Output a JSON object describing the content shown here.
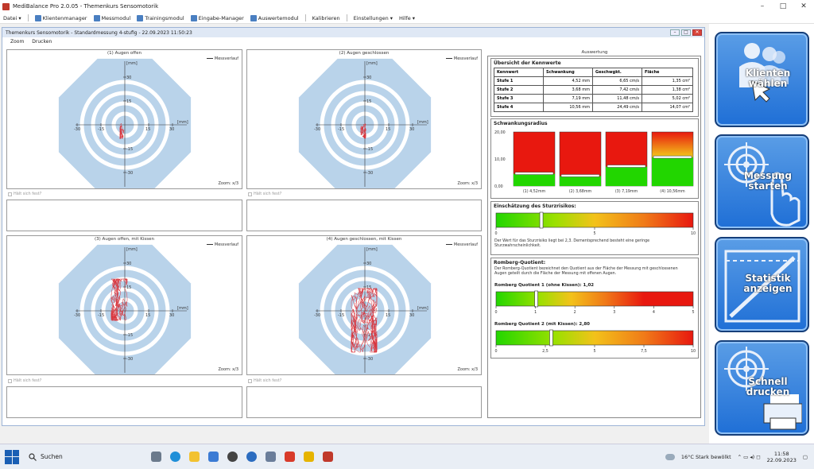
{
  "window": {
    "title": "MediBalance Pro   2.0.05 - Themenkurs Sensomotorik"
  },
  "menu": {
    "items": [
      "Datei",
      "Klientenmanager",
      "Messmodul",
      "Trainingsmodul",
      "Eingabe-Manager",
      "Auswertemodul",
      "Kalibrieren",
      "Einstellungen",
      "Hilfe"
    ]
  },
  "inner": {
    "title": "Themenkurs Sensomotorik - Standardmessung 4-stufig - 22.09.2023 11:50:23",
    "tools": [
      "Zoom",
      "Drucken"
    ]
  },
  "panels": [
    {
      "title": "(1) Augen offen",
      "legend": "Messverlauf",
      "zoom": "Zoom: x/3",
      "check": "Hält sich fest?"
    },
    {
      "title": "(2) Augen geschlossen",
      "legend": "Messverlauf",
      "zoom": "Zoom: x/3",
      "check": "Hält sich fest?"
    },
    {
      "title": "(3) Augen offen, mit Kissen",
      "legend": "Messverlauf",
      "zoom": "Zoom: x/3",
      "check": "Hält sich fest?"
    },
    {
      "title": "(4) Augen geschlossen, mit Kissen",
      "legend": "Messverlauf",
      "zoom": "Zoom: x/3",
      "check": "Hält sich fest?"
    }
  ],
  "axis_labels": {
    "unit": "[mm]",
    "ticks": [
      "30",
      "15",
      "-15",
      "-30"
    ]
  },
  "eval": {
    "header": "Auswertung",
    "overview_title": "Übersicht der Kennwerte",
    "table": {
      "headers": [
        "Kennwert",
        "Schwankung",
        "Geschwgkt.",
        "Fläche"
      ],
      "rows": [
        [
          "Stufe 1",
          "4,52 mm",
          "6,65 cm/s",
          "1,35 cm²"
        ],
        [
          "Stufe 2",
          "3,68 mm",
          "7,42 cm/s",
          "1,38 cm²"
        ],
        [
          "Stufe 3",
          "7,19 mm",
          "11,48 cm/s",
          "5,02 cm²"
        ],
        [
          "Stufe 4",
          "10,56 mm",
          "24,49 cm/s",
          "14,07 cm²"
        ]
      ]
    },
    "sway_title": "Schwankungsradius",
    "sway_axis": [
      "20,00",
      "10,00",
      "0,00"
    ],
    "sway_labels": [
      "(1) 4,52mm",
      "(2) 3,68mm",
      "(3) 7,19mm",
      "(4) 10,56mm"
    ],
    "fall_title": "Einschätzung des Sturzrisikos:",
    "fall_ticks": [
      "0",
      "5",
      "10"
    ],
    "fall_text": "Der Wert für das Sturzrisiko liegt bei 2,3. Dementsprechend besteht eine geringe Sturzwahrscheinlichkeit.",
    "romberg_title": "Romberg-Quotient:",
    "romberg_text": "Der Romberg-Quotient bezeichnet den Quotient aus der Fläche der Messung mit geschlossenen Augen geteilt durch die Fläche der Messung mit offenen Augen.",
    "rq1_label": "Romberg Quotient 1 (ohne Kissen): 1,02",
    "rq1_ticks": [
      "0",
      "1",
      "2",
      "3",
      "4",
      "5"
    ],
    "rq2_label": "Romberg Quotient 2 (mit Kissen): 2,80",
    "rq2_ticks": [
      "0",
      "2,5",
      "5",
      "7,5",
      "10"
    ]
  },
  "levels": {
    "fall_risk": {
      "value": 2.3,
      "max": 10
    },
    "rq1": {
      "value": 1.02,
      "max": 5
    },
    "rq2": {
      "value": 2.8,
      "max": 10
    },
    "sway": {
      "max": 20,
      "values": [
        4.52,
        3.68,
        7.19,
        10.56
      ]
    }
  },
  "buttons": [
    {
      "label1": "Klienten",
      "label2": "wählen"
    },
    {
      "label1": "Messung",
      "label2": "starten"
    },
    {
      "label1": "Statistik",
      "label2": "anzeigen"
    },
    {
      "label1": "Schnell",
      "label2": "drucken"
    }
  ],
  "taskbar": {
    "search": "Suchen",
    "weather": "16°C  Stark bewölkt",
    "time": "11:58",
    "date": "22.09.2023"
  },
  "colors": {
    "target_bg": "#b9d3ea",
    "ring": "#ffffff",
    "trace": "#d9363e",
    "button_blue": "#1f6fd6",
    "bar_red": "#e8180f",
    "bar_green": "#22d600"
  }
}
